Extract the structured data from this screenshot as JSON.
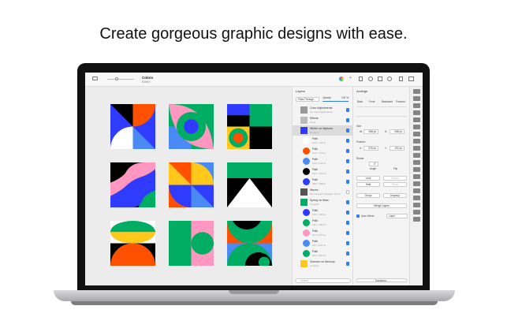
{
  "headline": "Create gorgeous graphic designs with ease.",
  "document": {
    "title": "Colors",
    "status": "Edited"
  },
  "layers": {
    "title": "Layers",
    "blend_mode": "Pass Through",
    "opacity_label": "Opacity",
    "opacity_value": "100 %",
    "opacity": 1.0,
    "items": [
      {
        "name": "Color Adjustments",
        "detail": "No Color Adjustments",
        "selected": false
      },
      {
        "name": "Effects",
        "detail": "None",
        "selected": false
      },
      {
        "name": "Winter on Neptune",
        "detail": "5 Layers",
        "selected": true
      },
      {
        "name": "Path",
        "detail": "144 × 144 px"
      },
      {
        "name": "Path",
        "detail": "144 × 144 px"
      },
      {
        "name": "Path",
        "detail": "144 × 144 px"
      },
      {
        "name": "Path",
        "detail": "144 × 144 px"
      },
      {
        "name": "Path",
        "detail": "288 × 288 px"
      },
      {
        "name": "Waves",
        "detail": "SF Compact, Regular, 224 pt"
      },
      {
        "name": "Spring on Mars",
        "detail": "5 Layers"
      },
      {
        "name": "Path",
        "detail": "180 × 180 px"
      },
      {
        "name": "Path",
        "detail": "180 × 180 px"
      },
      {
        "name": "Path",
        "detail": "207 × 207 px"
      },
      {
        "name": "Path",
        "detail": "207 × 207 px"
      },
      {
        "name": "Path",
        "detail": "207 × 207 px"
      },
      {
        "name": "Summer on Mercury",
        "detail": "4 Layers"
      }
    ],
    "search_placeholder": "Search"
  },
  "arrange": {
    "title": "Arrange",
    "order": [
      "Back",
      "Front",
      "Backward",
      "Forward"
    ],
    "size_label": "Size",
    "w_label": "W:",
    "w": "288 px",
    "h_label": "H:",
    "h": "288 px",
    "position_label": "Position",
    "x_label": "X:",
    "x": "576 px",
    "y_label": "Y:",
    "y": "192 px",
    "rotate_label": "Rotate",
    "angle": "0°",
    "angle_label": "Angle",
    "flip_label": "Flip",
    "lock": "Lock",
    "unlock": "Unlock",
    "hide": "Hide",
    "show": "Show",
    "group": "Group",
    "ungroup": "Ungroup",
    "merge": "Merge Layers",
    "auto_select": "Auto Select",
    "auto_select_mode": "Layer",
    "transform": "Transform..."
  }
}
